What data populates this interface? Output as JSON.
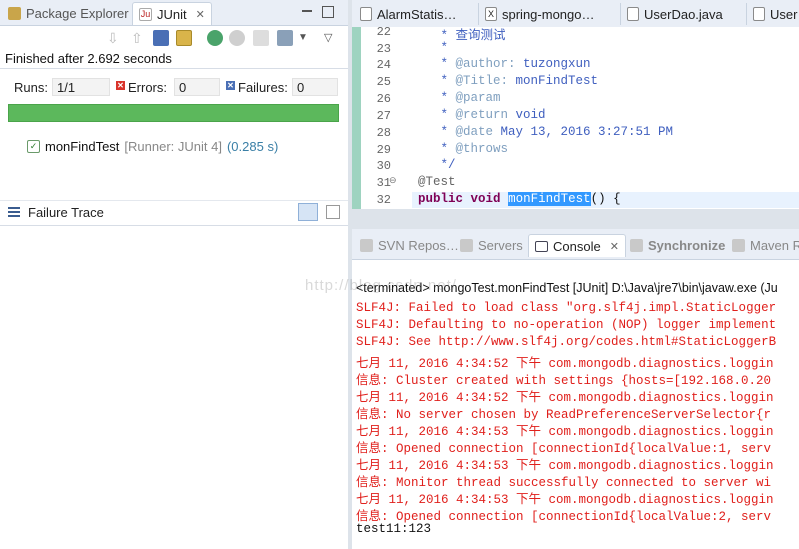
{
  "left": {
    "tabs": [
      {
        "label": "Package Explorer",
        "icon": "package-explorer-icon"
      },
      {
        "label": "JUnit",
        "icon": "junit-icon",
        "active": true
      }
    ],
    "finished_text": "Finished after 2.692 seconds",
    "runs_label": "Runs:",
    "runs_value": "1/1",
    "errors_label": "Errors:",
    "errors_value": "0",
    "failures_label": "Failures:",
    "failures_value": "0",
    "progress_fraction": 1.0,
    "progress_color": "#5cb85c",
    "test_name": "monFindTest",
    "test_runner": "[Runner: JUnit 4]",
    "test_time": "(0.285 s)",
    "failure_trace_label": "Failure Trace"
  },
  "editor": {
    "tabs": [
      {
        "label": "AlarmStatis…"
      },
      {
        "label": "spring-mongo…"
      },
      {
        "label": "UserDao.java"
      },
      {
        "label": "User"
      }
    ],
    "line_numbers": [
      "22",
      "23",
      "24",
      "25",
      "26",
      "27",
      "28",
      "29",
      "30",
      "31",
      "32"
    ],
    "lines": {
      "l22": "   * 查询测试",
      "l23": "   *",
      "l24_pre": "   * ",
      "l24_tag": "@author:",
      "l24_post": " tuzongxun",
      "l25_pre": "   * ",
      "l25_tag": "@Title:",
      "l25_post": " monFindTest",
      "l26_pre": "   * ",
      "l26_tag": "@param",
      "l27_pre": "   * ",
      "l27_tag": "@return",
      "l27_post": " void",
      "l28_pre": "   * ",
      "l28_tag": "@date",
      "l28_post": " May 13, 2016 3:27:51 PM",
      "l29_pre": "   * ",
      "l29_tag": "@throws",
      "l30": "   */",
      "l31": "@Test",
      "l32_kw1": "public",
      "l32_kw2": "void",
      "l32_method": "monFindTest",
      "l32_post": "() {"
    }
  },
  "console": {
    "tabs": [
      {
        "label": "SVN Repos…"
      },
      {
        "label": "Servers"
      },
      {
        "label": "Console",
        "active": true
      },
      {
        "label": "Synchronize"
      },
      {
        "label": "Maven R"
      }
    ],
    "terminated": "<terminated> mongoTest.monFindTest [JUnit] D:\\Java\\jre7\\bin\\javaw.exe (Ju",
    "lines": [
      "SLF4J: Failed to load class \"org.slf4j.impl.StaticLogger",
      "SLF4J: Defaulting to no-operation (NOP) logger implement",
      "SLF4J: See http://www.slf4j.org/codes.html#StaticLoggerB",
      "七月 11, 2016 4:34:52 下午 com.mongodb.diagnostics.loggin",
      "信息: Cluster created with settings {hosts=[192.168.0.20",
      "七月 11, 2016 4:34:52 下午 com.mongodb.diagnostics.loggin",
      "信息: No server chosen by ReadPreferenceServerSelector{r",
      "七月 11, 2016 4:34:53 下午 com.mongodb.diagnostics.loggin",
      "信息: Opened connection [connectionId{localValue:1, serv",
      "七月 11, 2016 4:34:53 下午 com.mongodb.diagnostics.loggin",
      "信息: Monitor thread successfully connected to server wi",
      "七月 11, 2016 4:34:53 下午 com.mongodb.diagnostics.loggin",
      "信息: Opened connection [connectionId{localValue:2, serv",
      "test11:123"
    ]
  },
  "watermark": "http://blog.csdn.net/"
}
